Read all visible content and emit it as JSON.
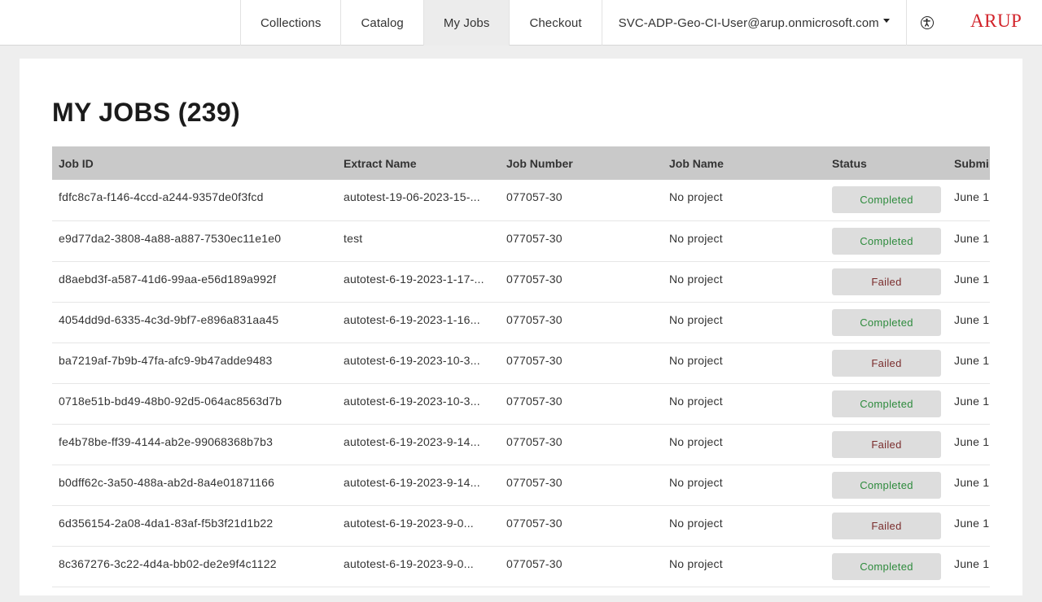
{
  "nav": {
    "items": [
      {
        "label": "Collections",
        "active": false
      },
      {
        "label": "Catalog",
        "active": false
      },
      {
        "label": "My Jobs",
        "active": true
      },
      {
        "label": "Checkout",
        "active": false
      }
    ],
    "user": "SVC-ADP-Geo-CI-User@arup.onmicrosoft.com",
    "logo": "ARUP",
    "accessibility_icon": "accessibility-icon"
  },
  "page": {
    "title": "MY JOBS (239)"
  },
  "colors": {
    "brand": "#d2232a",
    "completed": "#2e8b3d",
    "failed": "#7a2d2d"
  },
  "table": {
    "headers": [
      "Job ID",
      "Extract Name",
      "Job Number",
      "Job Name",
      "Status",
      "Submi"
    ],
    "rows": [
      {
        "job_id": "fdfc8c7a-f146-4ccd-a244-9357de0f3fcd",
        "extract": "autotest-19-06-2023-15-...",
        "number": "077057-30",
        "name": "No project",
        "status": "Completed",
        "submitted": "June 1"
      },
      {
        "job_id": "e9d77da2-3808-4a88-a887-7530ec11e1e0",
        "extract": "test",
        "number": "077057-30",
        "name": "No project",
        "status": "Completed",
        "submitted": "June 1"
      },
      {
        "job_id": "d8aebd3f-a587-41d6-99aa-e56d189a992f",
        "extract": "autotest-6-19-2023-1-17-...",
        "number": "077057-30",
        "name": "No project",
        "status": "Failed",
        "submitted": "June 1"
      },
      {
        "job_id": "4054dd9d-6335-4c3d-9bf7-e896a831aa45",
        "extract": "autotest-6-19-2023-1-16...",
        "number": "077057-30",
        "name": "No project",
        "status": "Completed",
        "submitted": "June 1"
      },
      {
        "job_id": "ba7219af-7b9b-47fa-afc9-9b47adde9483",
        "extract": "autotest-6-19-2023-10-3...",
        "number": "077057-30",
        "name": "No project",
        "status": "Failed",
        "submitted": "June 1"
      },
      {
        "job_id": "0718e51b-bd49-48b0-92d5-064ac8563d7b",
        "extract": "autotest-6-19-2023-10-3...",
        "number": "077057-30",
        "name": "No project",
        "status": "Completed",
        "submitted": "June 1"
      },
      {
        "job_id": "fe4b78be-ff39-4144-ab2e-99068368b7b3",
        "extract": "autotest-6-19-2023-9-14...",
        "number": "077057-30",
        "name": "No project",
        "status": "Failed",
        "submitted": "June 1"
      },
      {
        "job_id": "b0dff62c-3a50-488a-ab2d-8a4e01871166",
        "extract": "autotest-6-19-2023-9-14...",
        "number": "077057-30",
        "name": "No project",
        "status": "Completed",
        "submitted": "June 1"
      },
      {
        "job_id": "6d356154-2a08-4da1-83af-f5b3f21d1b22",
        "extract": "autotest-6-19-2023-9-0...",
        "number": "077057-30",
        "name": "No project",
        "status": "Failed",
        "submitted": "June 1"
      },
      {
        "job_id": "8c367276-3c22-4d4a-bb02-de2e9f4c1122",
        "extract": "autotest-6-19-2023-9-0...",
        "number": "077057-30",
        "name": "No project",
        "status": "Completed",
        "submitted": "June 1"
      }
    ]
  }
}
